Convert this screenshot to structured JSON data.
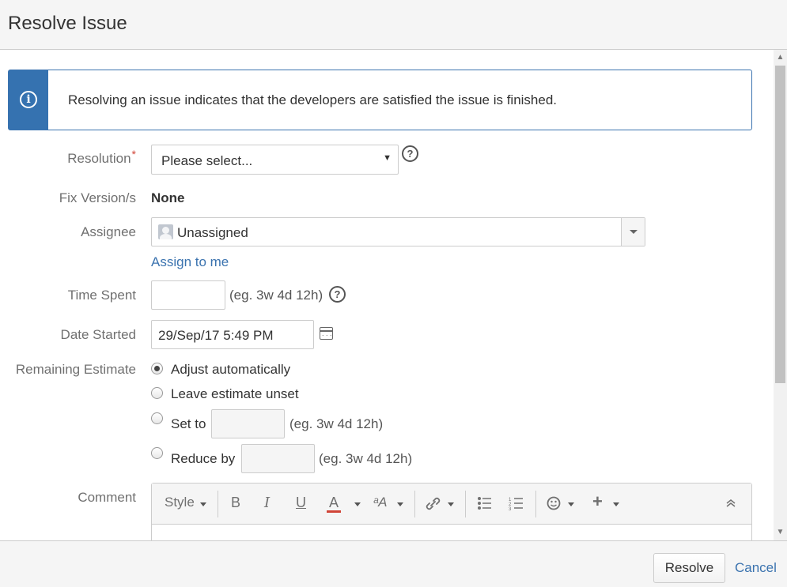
{
  "dialog": {
    "title": "Resolve Issue"
  },
  "info": {
    "message": "Resolving an issue indicates that the developers are satisfied the issue is finished."
  },
  "fields": {
    "resolution": {
      "label": "Resolution",
      "required_mark": "*",
      "value": "Please select..."
    },
    "fix_versions": {
      "label": "Fix Version/s",
      "value": "None"
    },
    "assignee": {
      "label": "Assignee",
      "value": "Unassigned",
      "assign_to_me": "Assign to me"
    },
    "time_spent": {
      "label": "Time Spent",
      "value": "",
      "hint": "(eg. 3w 4d 12h)"
    },
    "date_started": {
      "label": "Date Started",
      "value": "29/Sep/17 5:49 PM"
    },
    "remaining_estimate": {
      "label": "Remaining Estimate",
      "options": [
        {
          "label": "Adjust automatically",
          "checked": true
        },
        {
          "label": "Leave estimate unset",
          "checked": false
        },
        {
          "label": "Set to",
          "hint": "(eg. 3w 4d 12h)",
          "checked": false
        },
        {
          "label": "Reduce by",
          "hint": "(eg. 3w 4d 12h)",
          "checked": false
        }
      ]
    },
    "comment": {
      "label": "Comment"
    }
  },
  "editor_toolbar": {
    "style": "Style",
    "bold": "B",
    "italic": "I",
    "underline": "U",
    "text_color": "A",
    "text_color_bar": "#d04437"
  },
  "footer": {
    "resolve": "Resolve",
    "cancel": "Cancel"
  },
  "colors": {
    "accent": "#3572b0",
    "link": "#3b73af",
    "required": "#d04437"
  }
}
